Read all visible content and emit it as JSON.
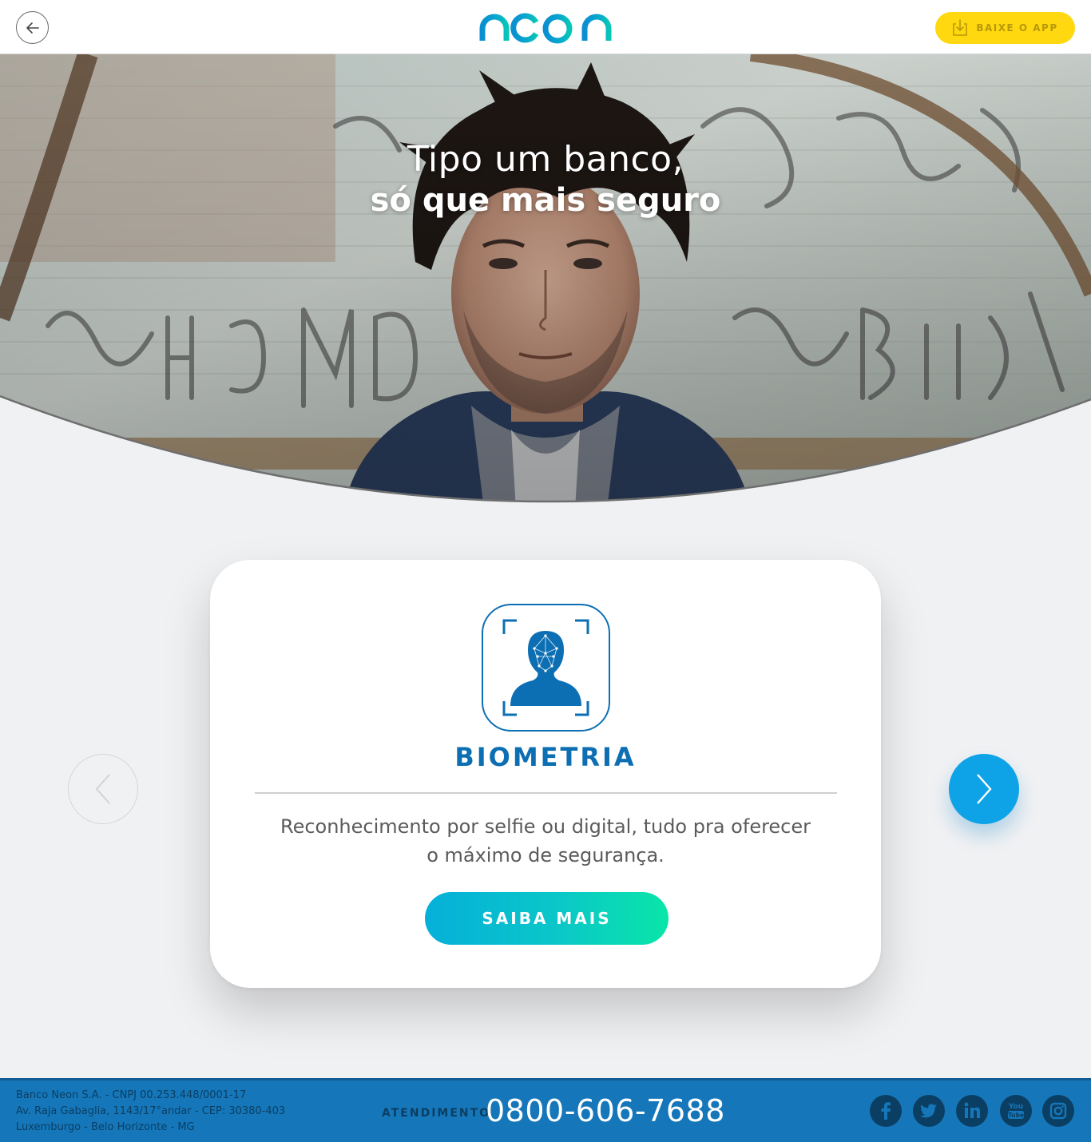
{
  "header": {
    "back_icon": "arrow-left-icon",
    "logo_text": "neon",
    "download_label": "BAIXE O APP",
    "download_icon": "download-icon"
  },
  "hero": {
    "line1": "Tipo um banco,",
    "line2": "só que mais seguro",
    "image": "portrait of young man with shaggy hair in front of graffiti wall"
  },
  "card": {
    "icon": "face-biometrics-icon",
    "title": "BIOMETRIA",
    "description": "Reconhecimento por selfie ou digital, tudo pra oferecer o máximo de segurança.",
    "cta_label": "SAIBA MAIS"
  },
  "carousel": {
    "prev_icon": "chevron-left-icon",
    "next_icon": "chevron-right-icon"
  },
  "footer": {
    "address_lines": [
      "Banco Neon S.A. - CNPJ 00.253.448/0001-17",
      "Av. Raja Gabaglia, 1143/17°andar - CEP: 30380-403",
      "Luxemburgo - Belo Horizonte - MG"
    ],
    "support_label": "ATENDIMENTO",
    "phone": "0800-606-7688",
    "social": [
      {
        "name": "facebook",
        "icon": "facebook-icon"
      },
      {
        "name": "twitter",
        "icon": "twitter-icon"
      },
      {
        "name": "linkedin",
        "icon": "linkedin-icon"
      },
      {
        "name": "youtube",
        "icon": "youtube-icon"
      },
      {
        "name": "instagram",
        "icon": "instagram-icon"
      }
    ]
  },
  "colors": {
    "brand_blue": "#0d6fb3",
    "accent_cyan": "#0da3e6",
    "download_yellow": "#ffd80f",
    "footer_blue": "#1577b9"
  }
}
